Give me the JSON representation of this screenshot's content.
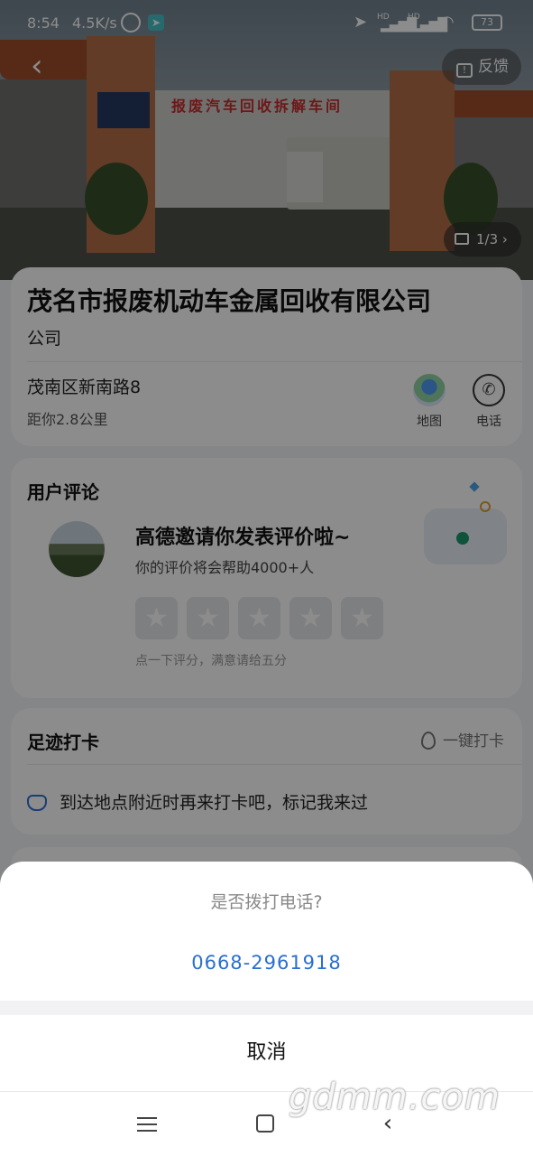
{
  "status_bar": {
    "time": "8:54",
    "net_speed": "4.5K/s",
    "battery": "73"
  },
  "header": {
    "feedback_label": "反馈",
    "photo_counter": "1/3"
  },
  "hero_photo": {
    "banner_text": "报废汽车回收拆解车间"
  },
  "place": {
    "name": "茂名市报废机动车金属回收有限公司",
    "category": "公司",
    "address": "茂南区新南路8",
    "distance": "距你2.8公里",
    "actions": [
      {
        "label": "地图",
        "icon": "map-pin-icon"
      },
      {
        "label": "电话",
        "icon": "phone-icon"
      }
    ]
  },
  "reviews": {
    "section_title": "用户评论",
    "invite_title": "高德邀请你发表评价啦~",
    "invite_subtitle": "你的评价将会帮助4000+人",
    "star_count": 5,
    "rating_hint": "点一下评分，满意请给五分"
  },
  "footprint": {
    "section_title": "足迹打卡",
    "checkin_label": "一键打卡",
    "hint": "到达地点附近时再来打卡吧，标记我来过"
  },
  "call_dialog": {
    "prompt": "是否拨打电话?",
    "phone_number": "0668-2961918",
    "cancel_label": "取消"
  },
  "watermark": "gdmm.com",
  "colors": {
    "accent_blue": "#2a6fd0",
    "overlay": "rgba(0,0,0,0.45)"
  }
}
